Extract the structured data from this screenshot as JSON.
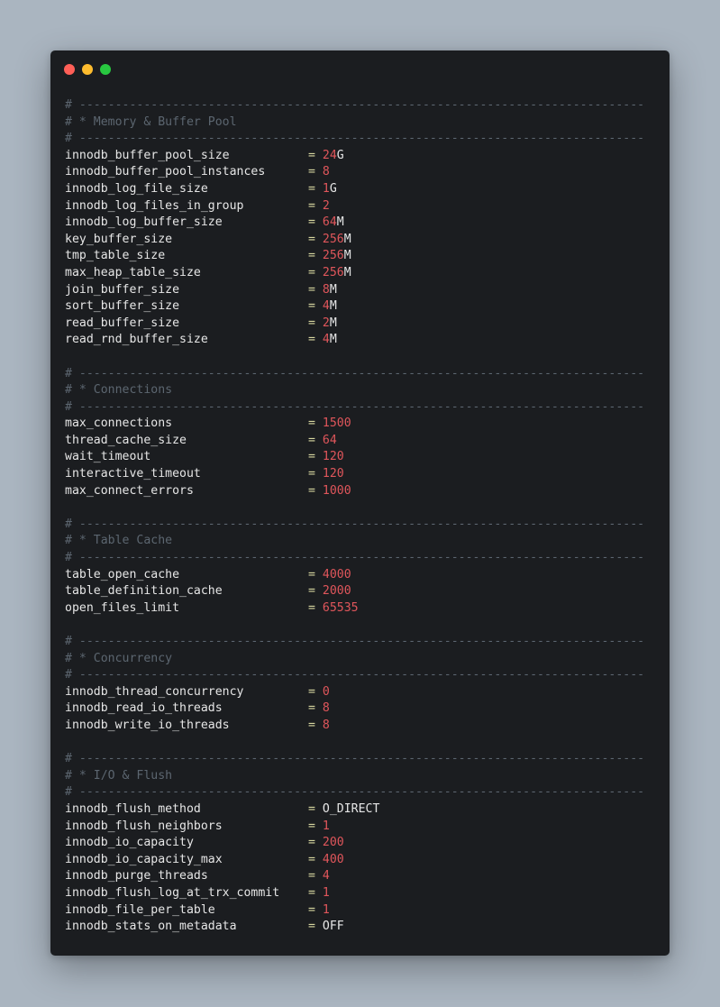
{
  "window": {
    "controls": [
      "close",
      "minimize",
      "zoom"
    ]
  },
  "colors": {
    "background": "#aab5c0",
    "editor_bg": "#1b1d20",
    "comment": "#5c6670",
    "key": "#e6e6e6",
    "equals": "#d7d7a0",
    "number": "#e0565b"
  },
  "rule": "# -------------------------------------------------------------------------------",
  "sections": [
    {
      "title": "# * Memory & Buffer Pool",
      "settings": [
        {
          "key": "innodb_buffer_pool_size",
          "num": "24",
          "unit": "G"
        },
        {
          "key": "innodb_buffer_pool_instances",
          "num": "8",
          "unit": ""
        },
        {
          "key": "innodb_log_file_size",
          "num": "1",
          "unit": "G"
        },
        {
          "key": "innodb_log_files_in_group",
          "num": "2",
          "unit": ""
        },
        {
          "key": "innodb_log_buffer_size",
          "num": "64",
          "unit": "M"
        },
        {
          "key": "key_buffer_size",
          "num": "256",
          "unit": "M"
        },
        {
          "key": "tmp_table_size",
          "num": "256",
          "unit": "M"
        },
        {
          "key": "max_heap_table_size",
          "num": "256",
          "unit": "M"
        },
        {
          "key": "join_buffer_size",
          "num": "8",
          "unit": "M"
        },
        {
          "key": "sort_buffer_size",
          "num": "4",
          "unit": "M"
        },
        {
          "key": "read_buffer_size",
          "num": "2",
          "unit": "M"
        },
        {
          "key": "read_rnd_buffer_size",
          "num": "4",
          "unit": "M"
        }
      ]
    },
    {
      "title": "# * Connections",
      "settings": [
        {
          "key": "max_connections",
          "num": "1500",
          "unit": ""
        },
        {
          "key": "thread_cache_size",
          "num": "64",
          "unit": ""
        },
        {
          "key": "wait_timeout",
          "num": "120",
          "unit": ""
        },
        {
          "key": "interactive_timeout",
          "num": "120",
          "unit": ""
        },
        {
          "key": "max_connect_errors",
          "num": "1000",
          "unit": ""
        }
      ]
    },
    {
      "title": "# * Table Cache",
      "settings": [
        {
          "key": "table_open_cache",
          "num": "4000",
          "unit": ""
        },
        {
          "key": "table_definition_cache",
          "num": "2000",
          "unit": ""
        },
        {
          "key": "open_files_limit",
          "num": "65535",
          "unit": ""
        }
      ]
    },
    {
      "title": "# * Concurrency",
      "settings": [
        {
          "key": "innodb_thread_concurrency",
          "num": "0",
          "unit": ""
        },
        {
          "key": "innodb_read_io_threads",
          "num": "8",
          "unit": ""
        },
        {
          "key": "innodb_write_io_threads",
          "num": "8",
          "unit": ""
        }
      ]
    },
    {
      "title": "# * I/O & Flush",
      "settings": [
        {
          "key": "innodb_flush_method",
          "str": "O_DIRECT"
        },
        {
          "key": "innodb_flush_neighbors",
          "num": "1",
          "unit": ""
        },
        {
          "key": "innodb_io_capacity",
          "num": "200",
          "unit": ""
        },
        {
          "key": "innodb_io_capacity_max",
          "num": "400",
          "unit": ""
        },
        {
          "key": "innodb_purge_threads",
          "num": "4",
          "unit": ""
        },
        {
          "key": "innodb_flush_log_at_trx_commit",
          "num": "1",
          "unit": ""
        },
        {
          "key": "innodb_file_per_table",
          "num": "1",
          "unit": ""
        },
        {
          "key": "innodb_stats_on_metadata",
          "str": "OFF"
        }
      ]
    }
  ]
}
